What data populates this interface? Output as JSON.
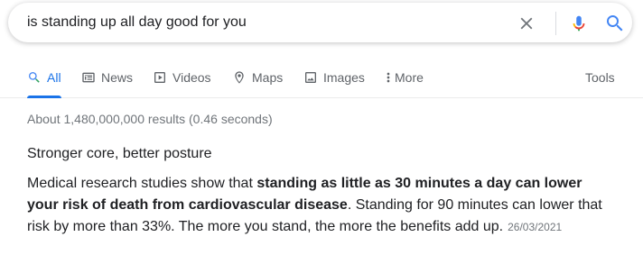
{
  "search": {
    "query": "is standing up all day good for you"
  },
  "tabs": [
    {
      "label": "All",
      "icon": "search-icon",
      "active": true
    },
    {
      "label": "News",
      "icon": "news-icon",
      "active": false
    },
    {
      "label": "Videos",
      "icon": "video-icon",
      "active": false
    },
    {
      "label": "Maps",
      "icon": "map-pin-icon",
      "active": false
    },
    {
      "label": "Images",
      "icon": "image-icon",
      "active": false
    },
    {
      "label": "More",
      "icon": "more-vert-icon",
      "active": false
    }
  ],
  "tools_label": "Tools",
  "results": {
    "stats": "About 1,480,000,000 results (0.46 seconds)"
  },
  "snippet": {
    "heading": "Stronger core, better posture",
    "text_before": "Medical research studies show that ",
    "text_bold": "standing as little as 30 minutes a day can lower your risk of death from cardiovascular disease",
    "text_after": ". Standing for 90 minutes can lower that risk by more than 33%. The more you stand, the more the benefits add up.",
    "date": "26/03/2021"
  },
  "colors": {
    "accent": "#1a73e8",
    "muted": "#70757a",
    "tab_text": "#5f6368",
    "text": "#202124"
  }
}
